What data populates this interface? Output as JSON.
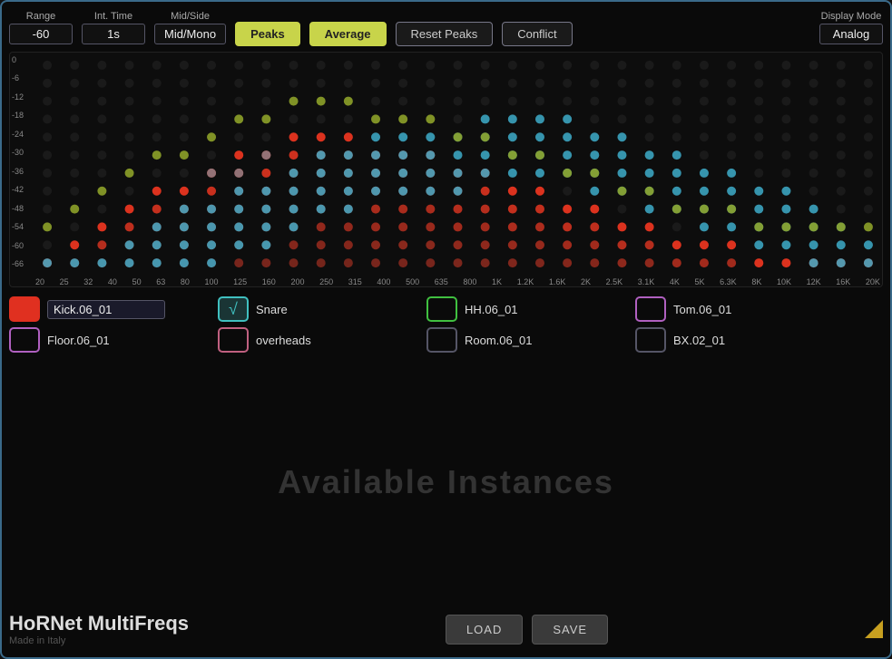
{
  "toolbar": {
    "range_label": "Range",
    "range_value": "-60",
    "inttime_label": "Int. Time",
    "inttime_value": "1s",
    "midside_label": "Mid/Side",
    "midside_value": "Mid/Mono",
    "peaks_label": "Peaks",
    "average_label": "Average",
    "reset_peaks_label": "Reset Peaks",
    "conflict_label": "Conflict",
    "display_mode_label": "Display Mode",
    "display_mode_value": "Analog"
  },
  "spectrum": {
    "y_labels": [
      "0",
      "-6",
      "-12",
      "-18",
      "-24",
      "-30",
      "-36",
      "-42",
      "-48",
      "-54",
      "-60",
      "-66"
    ],
    "x_labels": [
      "20",
      "25",
      "32",
      "40",
      "50",
      "63",
      "80",
      "100",
      "125",
      "160",
      "200",
      "250",
      "315",
      "400",
      "500",
      "635",
      "800",
      "1K",
      "1.2K",
      "1.6K",
      "2K",
      "2.5K",
      "3.1K",
      "4K",
      "5K",
      "6.3K",
      "8K",
      "10K",
      "12K",
      "16K",
      "20K"
    ]
  },
  "channels": [
    {
      "id": "kick",
      "label": "Kick.06_01",
      "style": "red-filled",
      "checkmark": "",
      "active": true
    },
    {
      "id": "snare",
      "label": "Snare",
      "style": "teal-border",
      "checkmark": "√",
      "active": true
    },
    {
      "id": "hh",
      "label": "HH.06_01",
      "style": "green-border",
      "checkmark": "",
      "active": false
    },
    {
      "id": "tom",
      "label": "Tom.06_01",
      "style": "purple-border",
      "checkmark": "",
      "active": false
    },
    {
      "id": "floor",
      "label": "Floor.06_01",
      "style": "purple-border",
      "checkmark": "",
      "active": false
    },
    {
      "id": "overheads",
      "label": "overheads",
      "style": "pink-border",
      "checkmark": "",
      "active": false
    },
    {
      "id": "room",
      "label": "Room.06_01",
      "style": "gray-border",
      "checkmark": "",
      "active": false
    },
    {
      "id": "bx",
      "label": "BX.02_01",
      "style": "gray-border",
      "checkmark": "",
      "active": false
    }
  ],
  "available_text": "Available Instances",
  "footer": {
    "title": "HoRNet MultiFreqs",
    "subtitle": "Made in Italy",
    "load_btn": "LOAD",
    "save_btn": "SAVE"
  }
}
